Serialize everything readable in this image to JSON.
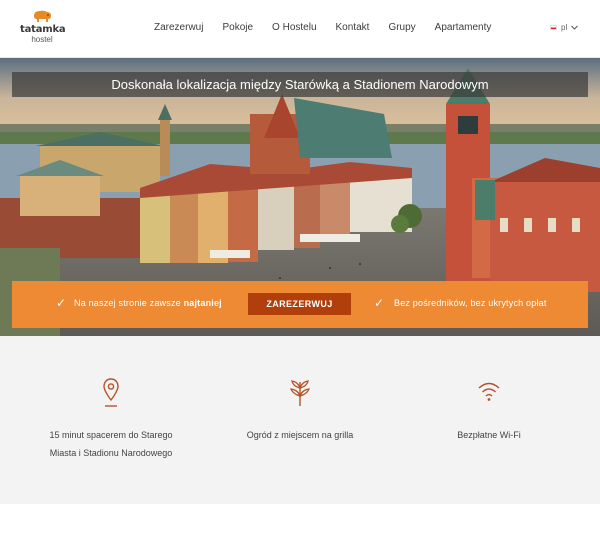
{
  "header": {
    "logo_name": "tatamka",
    "logo_sub": "hostel",
    "nav": [
      {
        "label": "Zarezerwuj"
      },
      {
        "label": "Pokoje"
      },
      {
        "label": "O Hostelu"
      },
      {
        "label": "Kontakt"
      },
      {
        "label": "Grupy"
      },
      {
        "label": "Apartamenty"
      }
    ],
    "language": "pl",
    "language_icon": "chevron-down-icon"
  },
  "hero": {
    "title": "Doskonała lokalizacja między Starówką a Stadionem Narodowym"
  },
  "cta": {
    "left_text": "Na naszej stronie zawsze",
    "left_bold": "najtaniej",
    "button_label": "ZAREZERWUJ",
    "right_text": "Bez pośredników, bez ukrytych opłat",
    "check_glyph": "✓",
    "bar_color": "#ee8a33",
    "button_color": "#b03f0c"
  },
  "features": [
    {
      "icon": "location-pin-icon",
      "line1": "15 minut spacerem do Starego",
      "line2": "Miasta i Stadionu Narodowego"
    },
    {
      "icon": "leaf-icon",
      "line1": "Ogród z miejscem na grilla",
      "line2": ""
    },
    {
      "icon": "wifi-icon",
      "line1": "Bezpłatne Wi-Fi",
      "line2": ""
    }
  ],
  "accent_color": "#b5532a"
}
